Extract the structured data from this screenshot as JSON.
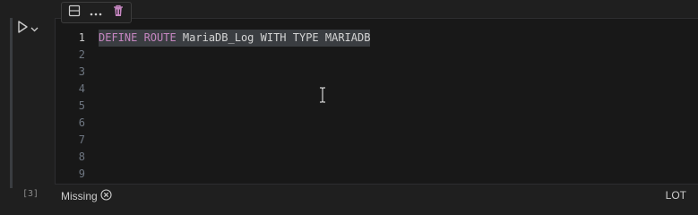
{
  "cell": {
    "execution_count": "[3]",
    "lines": [
      {
        "number": "1",
        "tokens": [
          {
            "text": "DEFINE ROUTE",
            "kind": "kw"
          },
          {
            "text": " MariaDB_Log WITH TYPE MARIADB",
            "kind": "plain"
          }
        ]
      },
      {
        "number": "2"
      },
      {
        "number": "3"
      },
      {
        "number": "4"
      },
      {
        "number": "5"
      },
      {
        "number": "6"
      },
      {
        "number": "7"
      },
      {
        "number": "8"
      },
      {
        "number": "9"
      }
    ]
  },
  "toolbar": {
    "split_icon": "split-cell-icon",
    "more_icon": "ellipsis-icon",
    "delete_icon": "trash-icon",
    "delete_color": "#c586c0"
  },
  "status": {
    "kernel_label": "Missing",
    "language": "LOT"
  },
  "colors": {
    "keyword": "#c586c0",
    "text": "#d4d4d4",
    "selection": "#3a3d41",
    "background": "#1f1f1f"
  }
}
